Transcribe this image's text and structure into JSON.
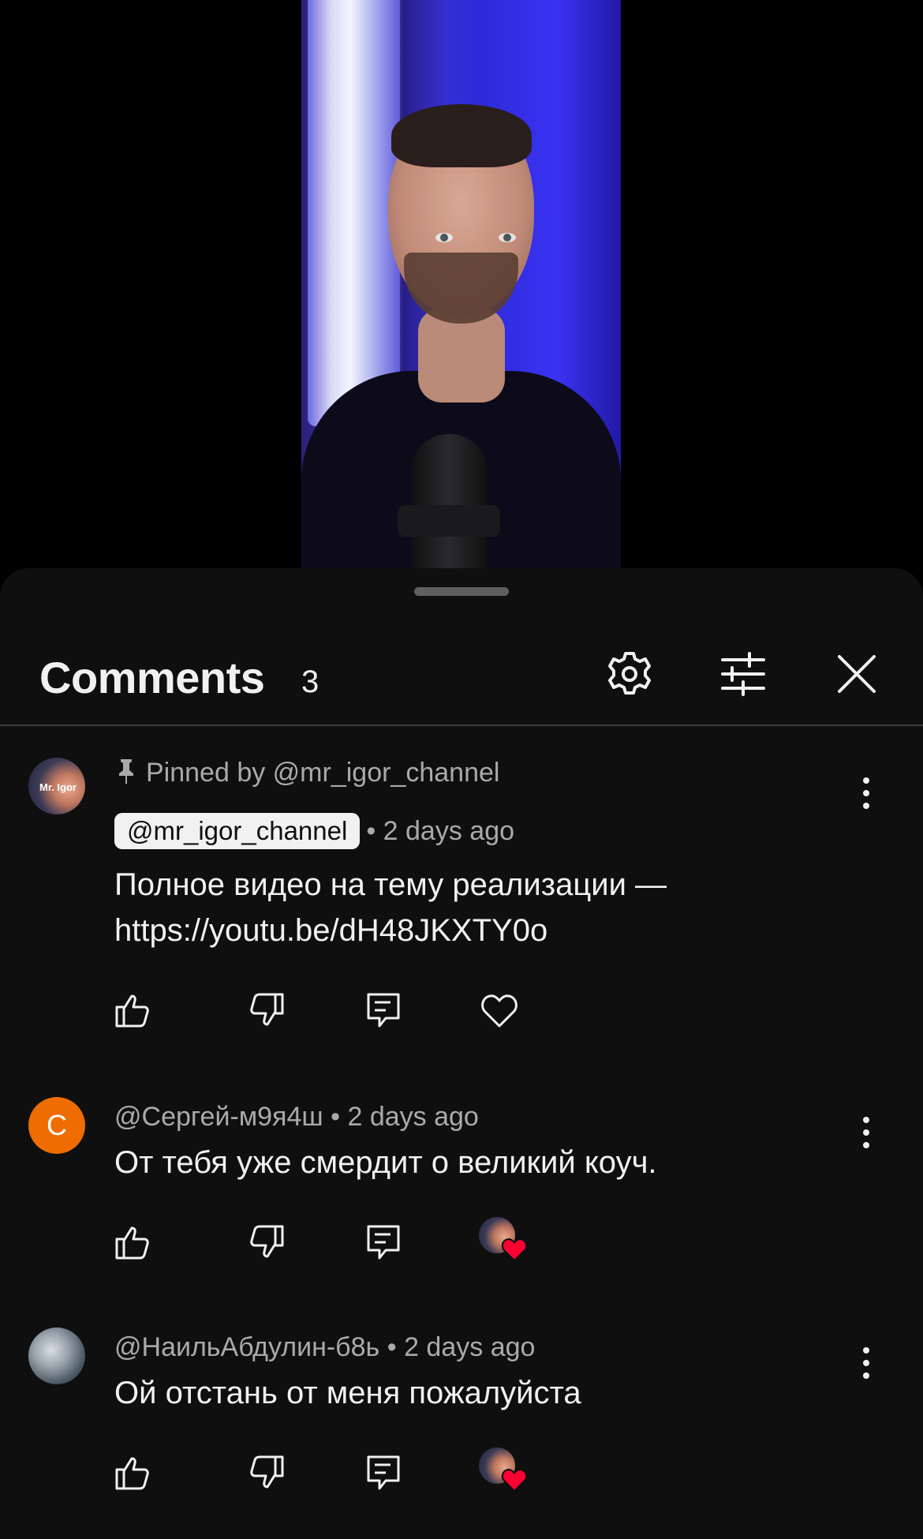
{
  "header": {
    "title": "Comments",
    "count": "3"
  },
  "icons": {
    "settings": "gear-icon",
    "filter": "sliders-icon",
    "close": "close-icon",
    "pin": "pin-icon",
    "more": "more-vertical-icon",
    "like": "thumbs-up-icon",
    "dislike": "thumbs-down-icon",
    "reply": "reply-icon",
    "heart": "heart-icon"
  },
  "colors": {
    "sheet_bg": "#0f0f0f",
    "text_primary": "#f1f1f1",
    "text_secondary": "#aaaaaa",
    "avatar_c": "#ef6c00",
    "heart_red": "#ff0033"
  },
  "comments": [
    {
      "pinned_label": "Pinned by @mr_igor_channel",
      "author": "@mr_igor_channel",
      "time": "• 2 days ago",
      "text": "Полное видео на тему реализации — https://youtu.be/dH48JKXTY0o",
      "avatar_text": "Mr. Igor",
      "hearted_by_creator": false
    },
    {
      "author": "@Сергей-м9я4ш",
      "time": "• 2 days ago",
      "text": "От тебя уже смердит о великий коуч.",
      "avatar_letter": "С",
      "hearted_by_creator": true
    },
    {
      "author": "@НаильАбдулин-б8ь",
      "time": "• 2 days ago",
      "text": "Ой отстань от меня пожалуйста",
      "hearted_by_creator": true
    }
  ]
}
